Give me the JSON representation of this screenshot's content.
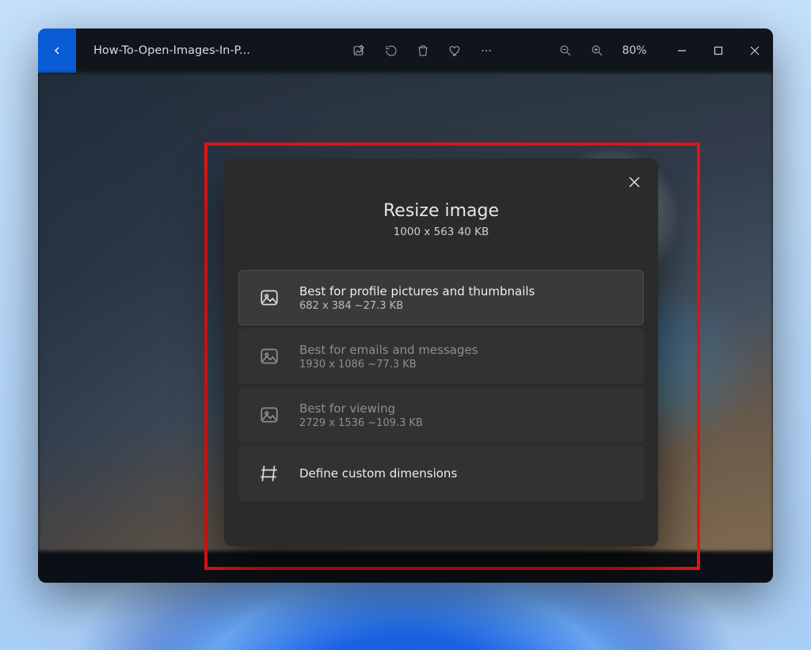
{
  "window": {
    "filename": "How-To-Open-Images-In-P...",
    "zoom": "80%"
  },
  "dialog": {
    "title": "Resize image",
    "subtitle": "1000 x 563   40 KB",
    "options": [
      {
        "label": "Best for profile pictures and thumbnails",
        "meta": "682 x 384   ~27.3 KB"
      },
      {
        "label": "Best for emails and messages",
        "meta": "1930 x 1086   ~77.3 KB"
      },
      {
        "label": "Best for viewing",
        "meta": "2729 x 1536   ~109.3 KB"
      },
      {
        "label": "Define custom dimensions"
      }
    ]
  }
}
